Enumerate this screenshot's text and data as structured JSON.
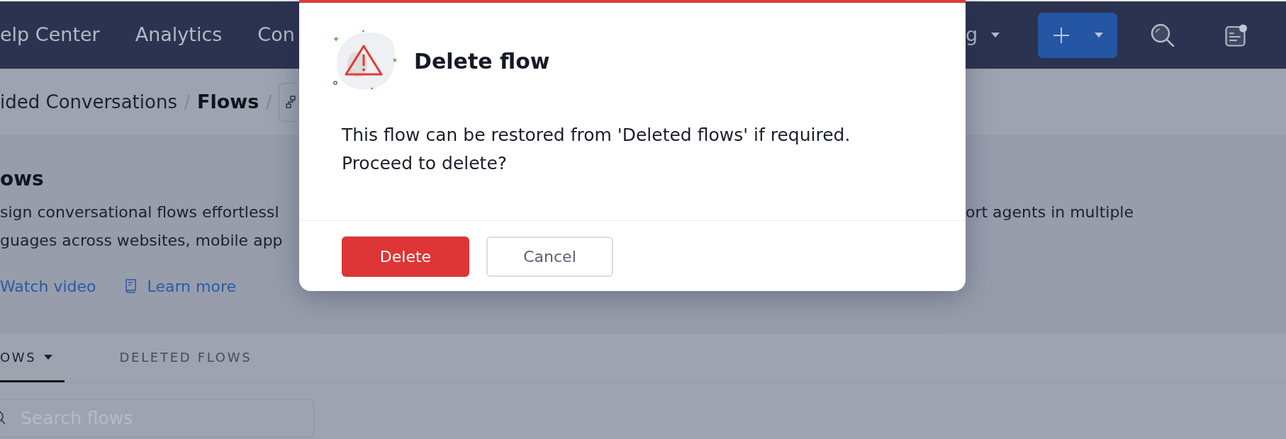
{
  "top_nav": {
    "items": [
      {
        "label": "elp Center"
      },
      {
        "label": "Analytics"
      },
      {
        "label": "Con"
      }
    ],
    "right_items": [
      {
        "label": "g",
        "dropdown": true
      }
    ]
  },
  "breadcrumb": [
    {
      "kind": "link",
      "label": "ided Conversations"
    },
    {
      "kind": "separator",
      "label": "/"
    },
    {
      "kind": "current",
      "label": "Flows"
    },
    {
      "kind": "separator",
      "label": "/"
    }
  ],
  "header": {
    "title": "ows",
    "description_left": [
      "sign conversational flows effortlessl",
      "guages across websites, mobile app"
    ],
    "description_right": [
      "ort agents in multiple"
    ],
    "links": [
      {
        "kind": "video",
        "label": "Watch video"
      },
      {
        "kind": "doc",
        "label": "Learn more"
      }
    ]
  },
  "tabs": [
    {
      "label": "OWS",
      "selected": true,
      "dropdown": true
    },
    {
      "label": "DELETED FLOWS",
      "selected": false,
      "dropdown": false
    }
  ],
  "search": {
    "placeholder": "Search flows"
  },
  "dialog": {
    "title": "Delete flow",
    "message": "This flow can be restored from 'Deleted flows' if required. Proceed to delete?",
    "buttons": [
      {
        "kind": "danger",
        "label": "Delete"
      },
      {
        "kind": "secondary",
        "label": "Cancel"
      }
    ]
  }
}
